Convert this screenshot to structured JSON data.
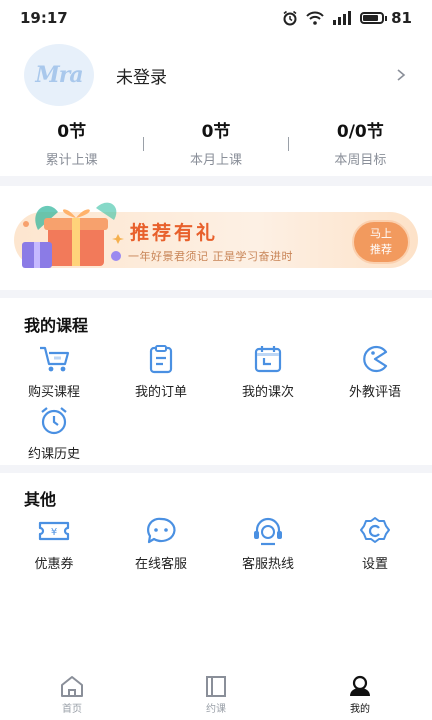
{
  "status_bar": {
    "time": "19:17",
    "battery": "81"
  },
  "profile": {
    "avatar_text": "Mra",
    "username": "未登录"
  },
  "stats": [
    {
      "value": "0节",
      "label": "累计上课"
    },
    {
      "value": "0节",
      "label": "本月上课"
    },
    {
      "value": "0/0节",
      "label": "本周目标"
    }
  ],
  "banner": {
    "title": "推荐有礼",
    "subtitle": "一年好景君须记  正是学习奋进时",
    "button_line1": "马上",
    "button_line2": "推荐",
    "accent_color": "#e8602c"
  },
  "my_courses": {
    "title": "我的课程",
    "items": [
      {
        "label": "购买课程",
        "icon": "cart-icon"
      },
      {
        "label": "我的订单",
        "icon": "clipboard-icon"
      },
      {
        "label": "我的课次",
        "icon": "calendar-icon"
      },
      {
        "label": "外教评语",
        "icon": "pacman-icon"
      },
      {
        "label": "约课历史",
        "icon": "alarm-clock-icon"
      }
    ]
  },
  "other": {
    "title": "其他",
    "items": [
      {
        "label": "优惠券",
        "icon": "coupon-icon"
      },
      {
        "label": "在线客服",
        "icon": "chat-bubble-icon"
      },
      {
        "label": "客服热线",
        "icon": "headset-icon"
      },
      {
        "label": "设置",
        "icon": "gear-icon"
      }
    ]
  },
  "bottom_nav": [
    {
      "label": "首页",
      "icon": "home-icon",
      "active": false
    },
    {
      "label": "约课",
      "icon": "book-icon",
      "active": false
    },
    {
      "label": "我的",
      "icon": "user-icon",
      "active": true
    }
  ],
  "icon_color": "#4a90e2"
}
